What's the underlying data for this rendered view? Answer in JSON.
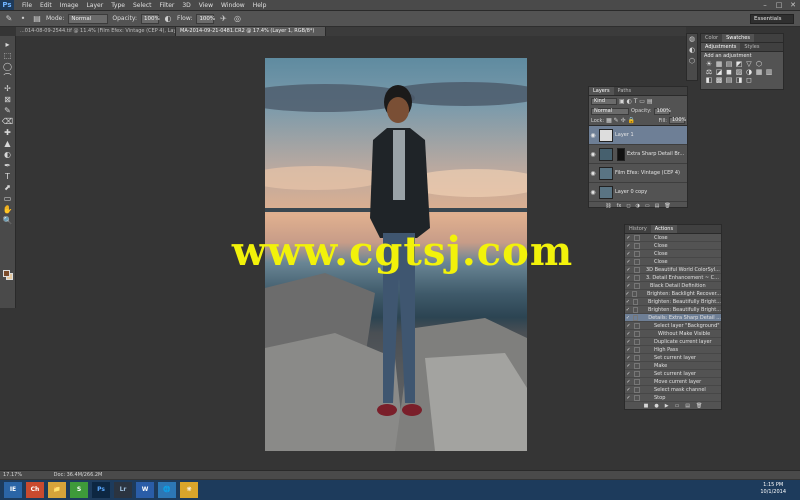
{
  "menubar": {
    "logo": "Ps",
    "items": [
      "File",
      "Edit",
      "Image",
      "Layer",
      "Type",
      "Select",
      "Filter",
      "3D",
      "View",
      "Window",
      "Help"
    ]
  },
  "options": {
    "mode_label": "Mode:",
    "mode_value": "Normal",
    "opacity_label": "Opacity:",
    "opacity_value": "100%",
    "flow_label": "Flow:",
    "flow_value": "100%",
    "workspace": "Essentials"
  },
  "tabs": [
    "...014-08-09-2544.tif @ 11.4% (Film Efex: Vintage (CEP 4), Layer Mask/8)",
    "MA-2014-09-21-0481.CR2 @ 17.4% (Layer 1, RGB/8*)"
  ],
  "tools": [
    "▸",
    "⬚",
    "◯",
    "⌒",
    "✢",
    "⊠",
    "✎",
    "⌫",
    "✚",
    "▲",
    "◐",
    "✒",
    "T",
    "⬈",
    "▭",
    "✋",
    "🔍"
  ],
  "statusbar": {
    "zoom": "17.17%",
    "doc": "Doc: 36.4M/266.2M"
  },
  "color_panel": {
    "tabs": [
      "Color",
      "Swatches"
    ],
    "subtabs": [
      "Adjustments",
      "Styles"
    ],
    "hint": "Add an adjustment",
    "icons_row1": [
      "☀",
      "▦",
      "▤",
      "◩",
      "▽",
      "⬡"
    ],
    "icons_row2": [
      "⚖",
      "◪",
      "◼",
      "▨",
      "◑",
      "▦",
      "▥"
    ],
    "icons_row3": [
      "◧",
      "▩",
      "▤",
      "◨",
      "◻"
    ]
  },
  "layers_panel": {
    "tabs": [
      "Layers",
      "Paths"
    ],
    "kind": "Kind",
    "blend": "Normal",
    "opacity_label": "Opacity:",
    "opacity": "100%",
    "lock_label": "Lock:",
    "fill_label": "Fill:",
    "fill": "100%",
    "layers": [
      {
        "name": "Layer 1",
        "selected": true
      },
      {
        "name": "Extra Sharp Detail Br...",
        "selected": false
      },
      {
        "name": "Film Efex: Vintage (CEP 4)",
        "selected": false
      },
      {
        "name": "Layer 0 copy",
        "selected": false
      }
    ],
    "footer": [
      "⛓",
      "fx",
      "◻",
      "◑",
      "▭",
      "▤",
      "🗑"
    ]
  },
  "history_panel": {
    "tabs": [
      "History",
      "Actions"
    ],
    "rows": [
      {
        "label": "Close",
        "indent": 3
      },
      {
        "label": "Close",
        "indent": 3
      },
      {
        "label": "Close",
        "indent": 3
      },
      {
        "label": "Close",
        "indent": 3
      },
      {
        "label": "3D Beautiful World ColorSyl...",
        "indent": 1
      },
      {
        "label": "3. Detail Enhancement ~ C...",
        "indent": 1
      },
      {
        "label": "Black Detail Definition",
        "indent": 2
      },
      {
        "label": "Brighten: Backlight Recover...",
        "indent": 2
      },
      {
        "label": "Brighten: Beautifully Bright...",
        "indent": 2
      },
      {
        "label": "Brighten: Beautifully Bright...",
        "indent": 2
      },
      {
        "label": "Details: Extra Sharp Detail ...",
        "indent": 2
      },
      {
        "label": "Select layer \"Background\"",
        "indent": 3
      },
      {
        "label": "Without Make Visible",
        "indent": 4
      },
      {
        "label": "Duplicate current layer",
        "indent": 3
      },
      {
        "label": "High Pass",
        "indent": 3
      },
      {
        "label": "Set current layer",
        "indent": 3
      },
      {
        "label": "Make",
        "indent": 3
      },
      {
        "label": "Set current layer",
        "indent": 3
      },
      {
        "label": "Move current layer",
        "indent": 3
      },
      {
        "label": "Select mask channel",
        "indent": 3
      },
      {
        "label": "Stop",
        "indent": 3
      }
    ],
    "footer": [
      "■",
      "●",
      "▶",
      "▭",
      "▤",
      "🗑"
    ]
  },
  "watermark": "www.cgtsj.com",
  "taskbar": {
    "apps": [
      "IE",
      "Ch",
      "📁",
      "S",
      "Ps",
      "Lr",
      "W",
      "🌐",
      "❋"
    ],
    "time": "1:15 PM",
    "date": "10/1/2014"
  }
}
